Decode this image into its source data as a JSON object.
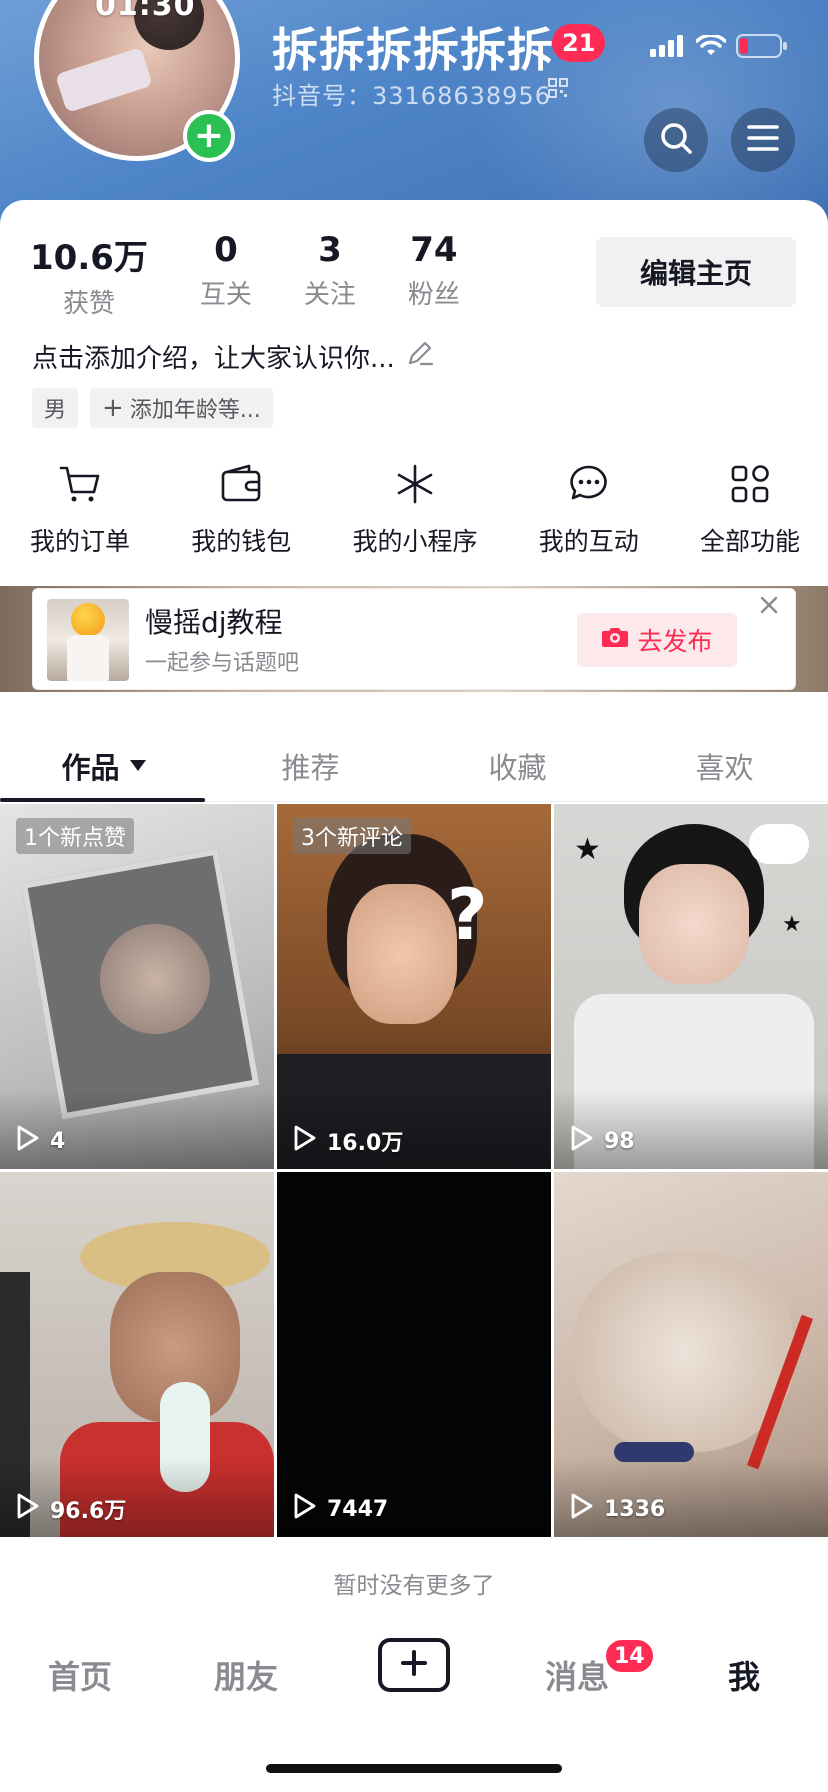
{
  "header": {
    "avatar_time": "01:30",
    "username": "拆拆拆拆拆拆",
    "notification_count": "21",
    "douyin_id": "抖音号：33168638956",
    "icons": [
      "qr-code-icon",
      "search-icon",
      "menu-icon"
    ]
  },
  "status_bar": {
    "icons": [
      "signal-icon",
      "wifi-icon",
      "battery-icon"
    ],
    "battery_color": "#fe2c55"
  },
  "stats": [
    {
      "value": "10.6万",
      "label": "获赞"
    },
    {
      "value": "0",
      "label": "互关"
    },
    {
      "value": "3",
      "label": "关注"
    },
    {
      "value": "74",
      "label": "粉丝"
    }
  ],
  "edit_profile_label": "编辑主页",
  "bio": "点击添加介绍，让大家认识你...",
  "tags": {
    "gender": "男",
    "add_age": "添加年龄等..."
  },
  "quick_actions": [
    {
      "label": "我的订单",
      "icon": "cart-icon"
    },
    {
      "label": "我的钱包",
      "icon": "wallet-icon"
    },
    {
      "label": "我的小程序",
      "icon": "mini-program-icon"
    },
    {
      "label": "我的互动",
      "icon": "chat-bubble-icon"
    },
    {
      "label": "全部功能",
      "icon": "grid-apps-icon"
    }
  ],
  "topic_banner": {
    "title": "慢摇dj教程",
    "subtitle": "一起参与话题吧",
    "publish_label": "去发布"
  },
  "tabs": [
    {
      "label": "作品",
      "active": true
    },
    {
      "label": "推荐",
      "active": false
    },
    {
      "label": "收藏",
      "active": false
    },
    {
      "label": "喜欢",
      "active": false
    }
  ],
  "videos": [
    {
      "badge": "1个新点赞",
      "views": "4"
    },
    {
      "badge": "3个新评论",
      "views": "16.0万"
    },
    {
      "badge": "",
      "views": "98"
    },
    {
      "badge": "",
      "views": "96.6万"
    },
    {
      "badge": "",
      "views": "7447"
    },
    {
      "badge": "",
      "views": "1336"
    }
  ],
  "no_more_text": "暂时没有更多了",
  "bottom_nav": {
    "home": "首页",
    "friends": "朋友",
    "messages": "消息",
    "messages_badge": "14",
    "me": "我"
  },
  "colors": {
    "accent": "#fe2c55",
    "header_blue": "#4f86c9",
    "green_add": "#2bc152"
  }
}
